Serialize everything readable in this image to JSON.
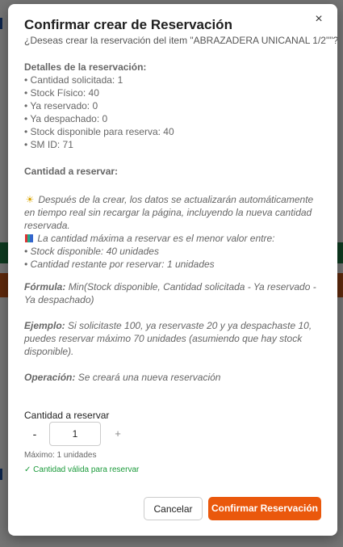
{
  "modal": {
    "title": "Confirmar crear de Reservación",
    "close_symbol": "×",
    "question": "¿Deseas crear la reservación del item \"ABRAZADERA UNICANAL 1/2\"\"?"
  },
  "details": {
    "heading": "Detalles de la reservación:",
    "items": [
      "• Cantidad solicitada: 1",
      "• Stock Físico: 40",
      "• Ya reservado: 0",
      "• Ya despachado: 0",
      "• Stock disponible para reserva: 40",
      "• SM ID: 71"
    ]
  },
  "quantity_section": {
    "heading": "Cantidad a reservar:"
  },
  "info": {
    "bulb_icon": "lightbulb-icon",
    "chart_icon": "bar-chart-icon",
    "update_note": "Después de la crear, los datos se actualizarán automáticamente en tiempo real sin recargar la página, incluyendo la nueva cantidad reservada.",
    "max_note": "La cantidad máxima a reservar es el menor valor entre:",
    "bullets": [
      "• Stock disponible: 40 unidades",
      "• Cantidad restante por reservar: 1 unidades"
    ]
  },
  "formula": {
    "label": "Fórmula:",
    "text": "Min(Stock disponible, Cantidad solicitada - Ya reservado - Ya despachado)"
  },
  "example": {
    "label": "Ejemplo:",
    "text": "Si solicitaste 100, ya reservaste 20 y ya despachaste 10, puedes reservar máximo 70 unidades (asumiendo que hay stock disponible)."
  },
  "operation": {
    "label": "Operación:",
    "text": "Se creará una nueva reservación"
  },
  "input": {
    "label": "Cantidad a reservar",
    "minus": "-",
    "value": "1",
    "plus": "+",
    "max_text": "Máximo: 1 unidades",
    "valid_text": "✓ Cantidad válida para reservar"
  },
  "footer": {
    "cancel_label": "Cancelar",
    "confirm_label": "Confirmar Reservación"
  },
  "colors": {
    "confirm_button": "#ea580c",
    "valid_text": "#1a9a3a"
  }
}
